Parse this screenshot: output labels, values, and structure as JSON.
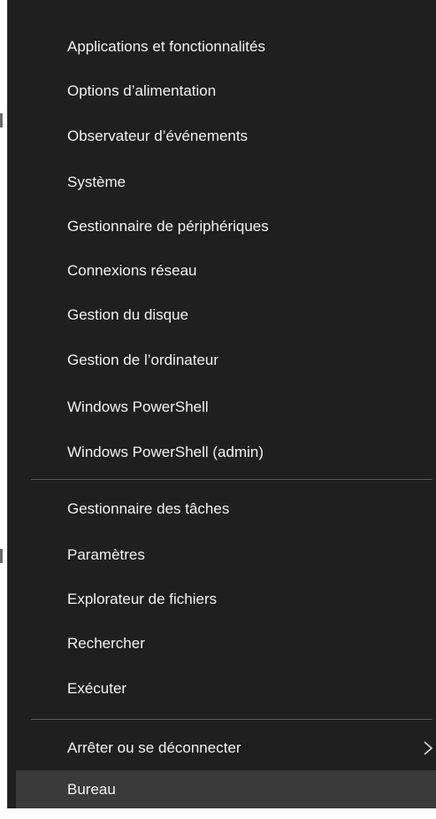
{
  "menu": {
    "group1": [
      {
        "label": "Applications et fonctionnalités"
      },
      {
        "label": "Options d’alimentation"
      },
      {
        "label": "Observateur d’événements"
      },
      {
        "label": "Système"
      },
      {
        "label": "Gestionnaire de périphériques"
      },
      {
        "label": "Connexions réseau"
      },
      {
        "label": "Gestion du disque"
      },
      {
        "label": "Gestion de l’ordinateur"
      },
      {
        "label": "Windows PowerShell"
      },
      {
        "label": "Windows PowerShell (admin)"
      }
    ],
    "group2": [
      {
        "label": "Gestionnaire des tâches"
      },
      {
        "label": "Paramètres"
      },
      {
        "label": "Explorateur de fichiers"
      },
      {
        "label": "Rechercher"
      },
      {
        "label": "Exécuter"
      }
    ],
    "group3": [
      {
        "label": "Arrêter ou se déconnecter",
        "has_submenu": true,
        "submenu_icon": "chevron-right-icon"
      },
      {
        "label": "Bureau",
        "highlighted": true
      }
    ],
    "colors": {
      "background": "#1f1f1f",
      "text": "#f2f2f2",
      "highlight": "#3a3a3a",
      "separator": "#5a5a5a"
    }
  }
}
